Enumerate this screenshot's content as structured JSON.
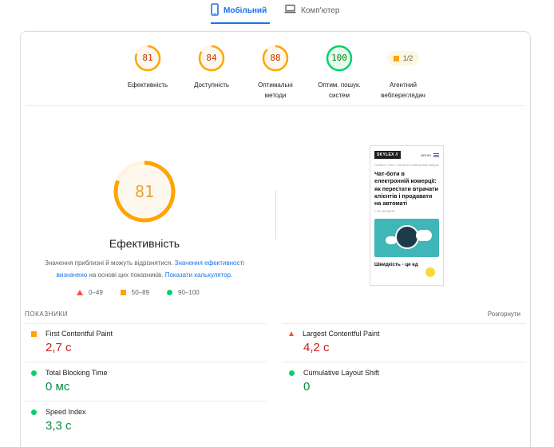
{
  "tabs": {
    "mobile": "Мобільний",
    "desktop": "Комп'ютер"
  },
  "categories": [
    {
      "score": "81",
      "label_line1": "Ефективність",
      "label_line2": "",
      "color": "#ffa400",
      "fraction": 0.81
    },
    {
      "score": "84",
      "label_line1": "Доступність",
      "label_line2": "",
      "color": "#ffa400",
      "fraction": 0.84
    },
    {
      "score": "88",
      "label_line1": "Оптимальні",
      "label_line2": "методи",
      "color": "#ffa400",
      "fraction": 0.88
    },
    {
      "score": "100",
      "label_line1": "Оптим. пошук.",
      "label_line2": "систем",
      "color": "#0cce6b",
      "fraction": 1.0
    }
  ],
  "pwa": {
    "value": "1/2",
    "label_line1": "Агентний",
    "label_line2": "вебпереглядач"
  },
  "performance": {
    "score": "81",
    "fraction": 0.81,
    "title": "Ефективність",
    "desc_1": "Значення приблизні й можуть відрізнятися.",
    "desc_link1": "Значення ефективності визначено",
    "desc_2": "на основі цих показників.",
    "desc_link2": "Показати калькулятор."
  },
  "legend": {
    "fail": "0–49",
    "average": "50–89",
    "pass": "90–100"
  },
  "screenshot": {
    "logo": "SKYLEX //",
    "menu": "МЕНЮ",
    "breadcrumb": "Головна » Блог » Чат-боти в електронній комерції",
    "title": "Чат-боти в електронній комерції: як перестати втрачати клієнтів і продавати на автоматі",
    "meta": "1 ХВ ЧИТАННЯ",
    "footer": "Швидкість - це ед"
  },
  "metrics": {
    "header": "ПОКАЗНИКИ",
    "expand": "Розгорнути",
    "items": [
      {
        "name": "First Contentful Paint",
        "value": "2,7 с",
        "status": "average"
      },
      {
        "name": "Largest Contentful Paint",
        "value": "4,2 с",
        "status": "fail"
      },
      {
        "name": "Total Blocking Time",
        "value": "0 мс",
        "status": "pass"
      },
      {
        "name": "Cumulative Layout Shift",
        "value": "0",
        "status": "pass"
      },
      {
        "name": "Speed Index",
        "value": "3,3 с",
        "status": "average"
      }
    ]
  }
}
